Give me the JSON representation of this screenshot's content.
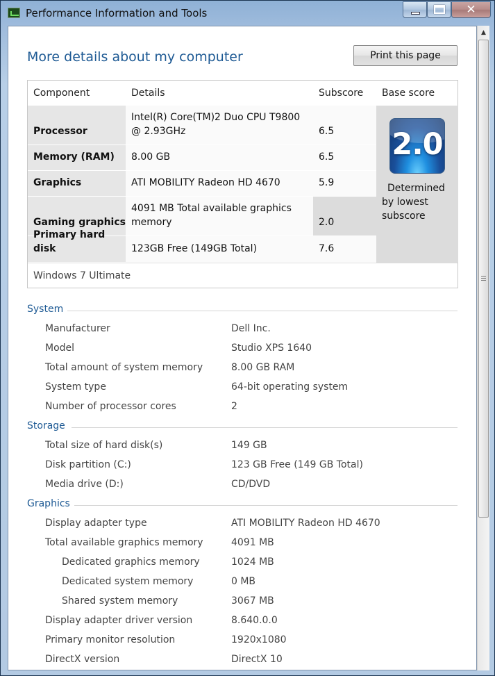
{
  "window": {
    "title": "Performance Information and Tools",
    "min_glyph": "",
    "close_glyph": "✕"
  },
  "page": {
    "title": "More details about my computer",
    "print_button": "Print this page"
  },
  "score_table": {
    "headers": {
      "component": "Component",
      "details": "Details",
      "subscore": "Subscore",
      "base": "Base score"
    },
    "rows": [
      {
        "component": "Processor",
        "details": "Intel(R) Core(TM)2 Duo CPU T9800 @ 2.93GHz",
        "subscore": "6.5"
      },
      {
        "component": "Memory (RAM)",
        "details": "8.00 GB",
        "subscore": "6.5"
      },
      {
        "component": "Graphics",
        "details": "ATI MOBILITY Radeon HD 4670",
        "subscore": "5.9"
      },
      {
        "component": "Gaming graphics",
        "details": "4091 MB Total available graphics memory",
        "subscore": "2.0"
      },
      {
        "component": "Primary hard disk",
        "details": "123GB Free (149GB Total)",
        "subscore": "7.6"
      }
    ],
    "base_score": "2.0",
    "base_note_1": "Determined",
    "base_note_2": "by lowest subscore",
    "os": "Windows 7 Ultimate"
  },
  "system": {
    "heading": "System",
    "items": [
      {
        "label": "Manufacturer",
        "value": "Dell Inc."
      },
      {
        "label": "Model",
        "value": "Studio XPS 1640"
      },
      {
        "label": "Total amount of system memory",
        "value": "8.00 GB RAM"
      },
      {
        "label": "System type",
        "value": "64-bit operating system"
      },
      {
        "label": "Number of processor cores",
        "value": "2"
      }
    ]
  },
  "storage": {
    "heading": "Storage",
    "items": [
      {
        "label": "Total size of hard disk(s)",
        "value": "149 GB"
      },
      {
        "label": "Disk partition (C:)",
        "value": "123 GB Free (149 GB Total)"
      },
      {
        "label": "Media drive (D:)",
        "value": "CD/DVD"
      }
    ]
  },
  "graphics": {
    "heading": "Graphics",
    "items": [
      {
        "label": "Display adapter type",
        "value": "ATI MOBILITY Radeon HD 4670"
      },
      {
        "label": "Total available graphics memory",
        "value": "4091 MB"
      },
      {
        "label": "Dedicated graphics memory",
        "value": "1024 MB"
      },
      {
        "label": "Dedicated system memory",
        "value": "0 MB"
      },
      {
        "label": "Shared system memory",
        "value": "3067 MB"
      },
      {
        "label": "Display adapter driver version",
        "value": "8.640.0.0"
      },
      {
        "label": "Primary monitor resolution",
        "value": "1920x1080"
      },
      {
        "label": "DirectX version",
        "value": "DirectX 10"
      }
    ]
  }
}
